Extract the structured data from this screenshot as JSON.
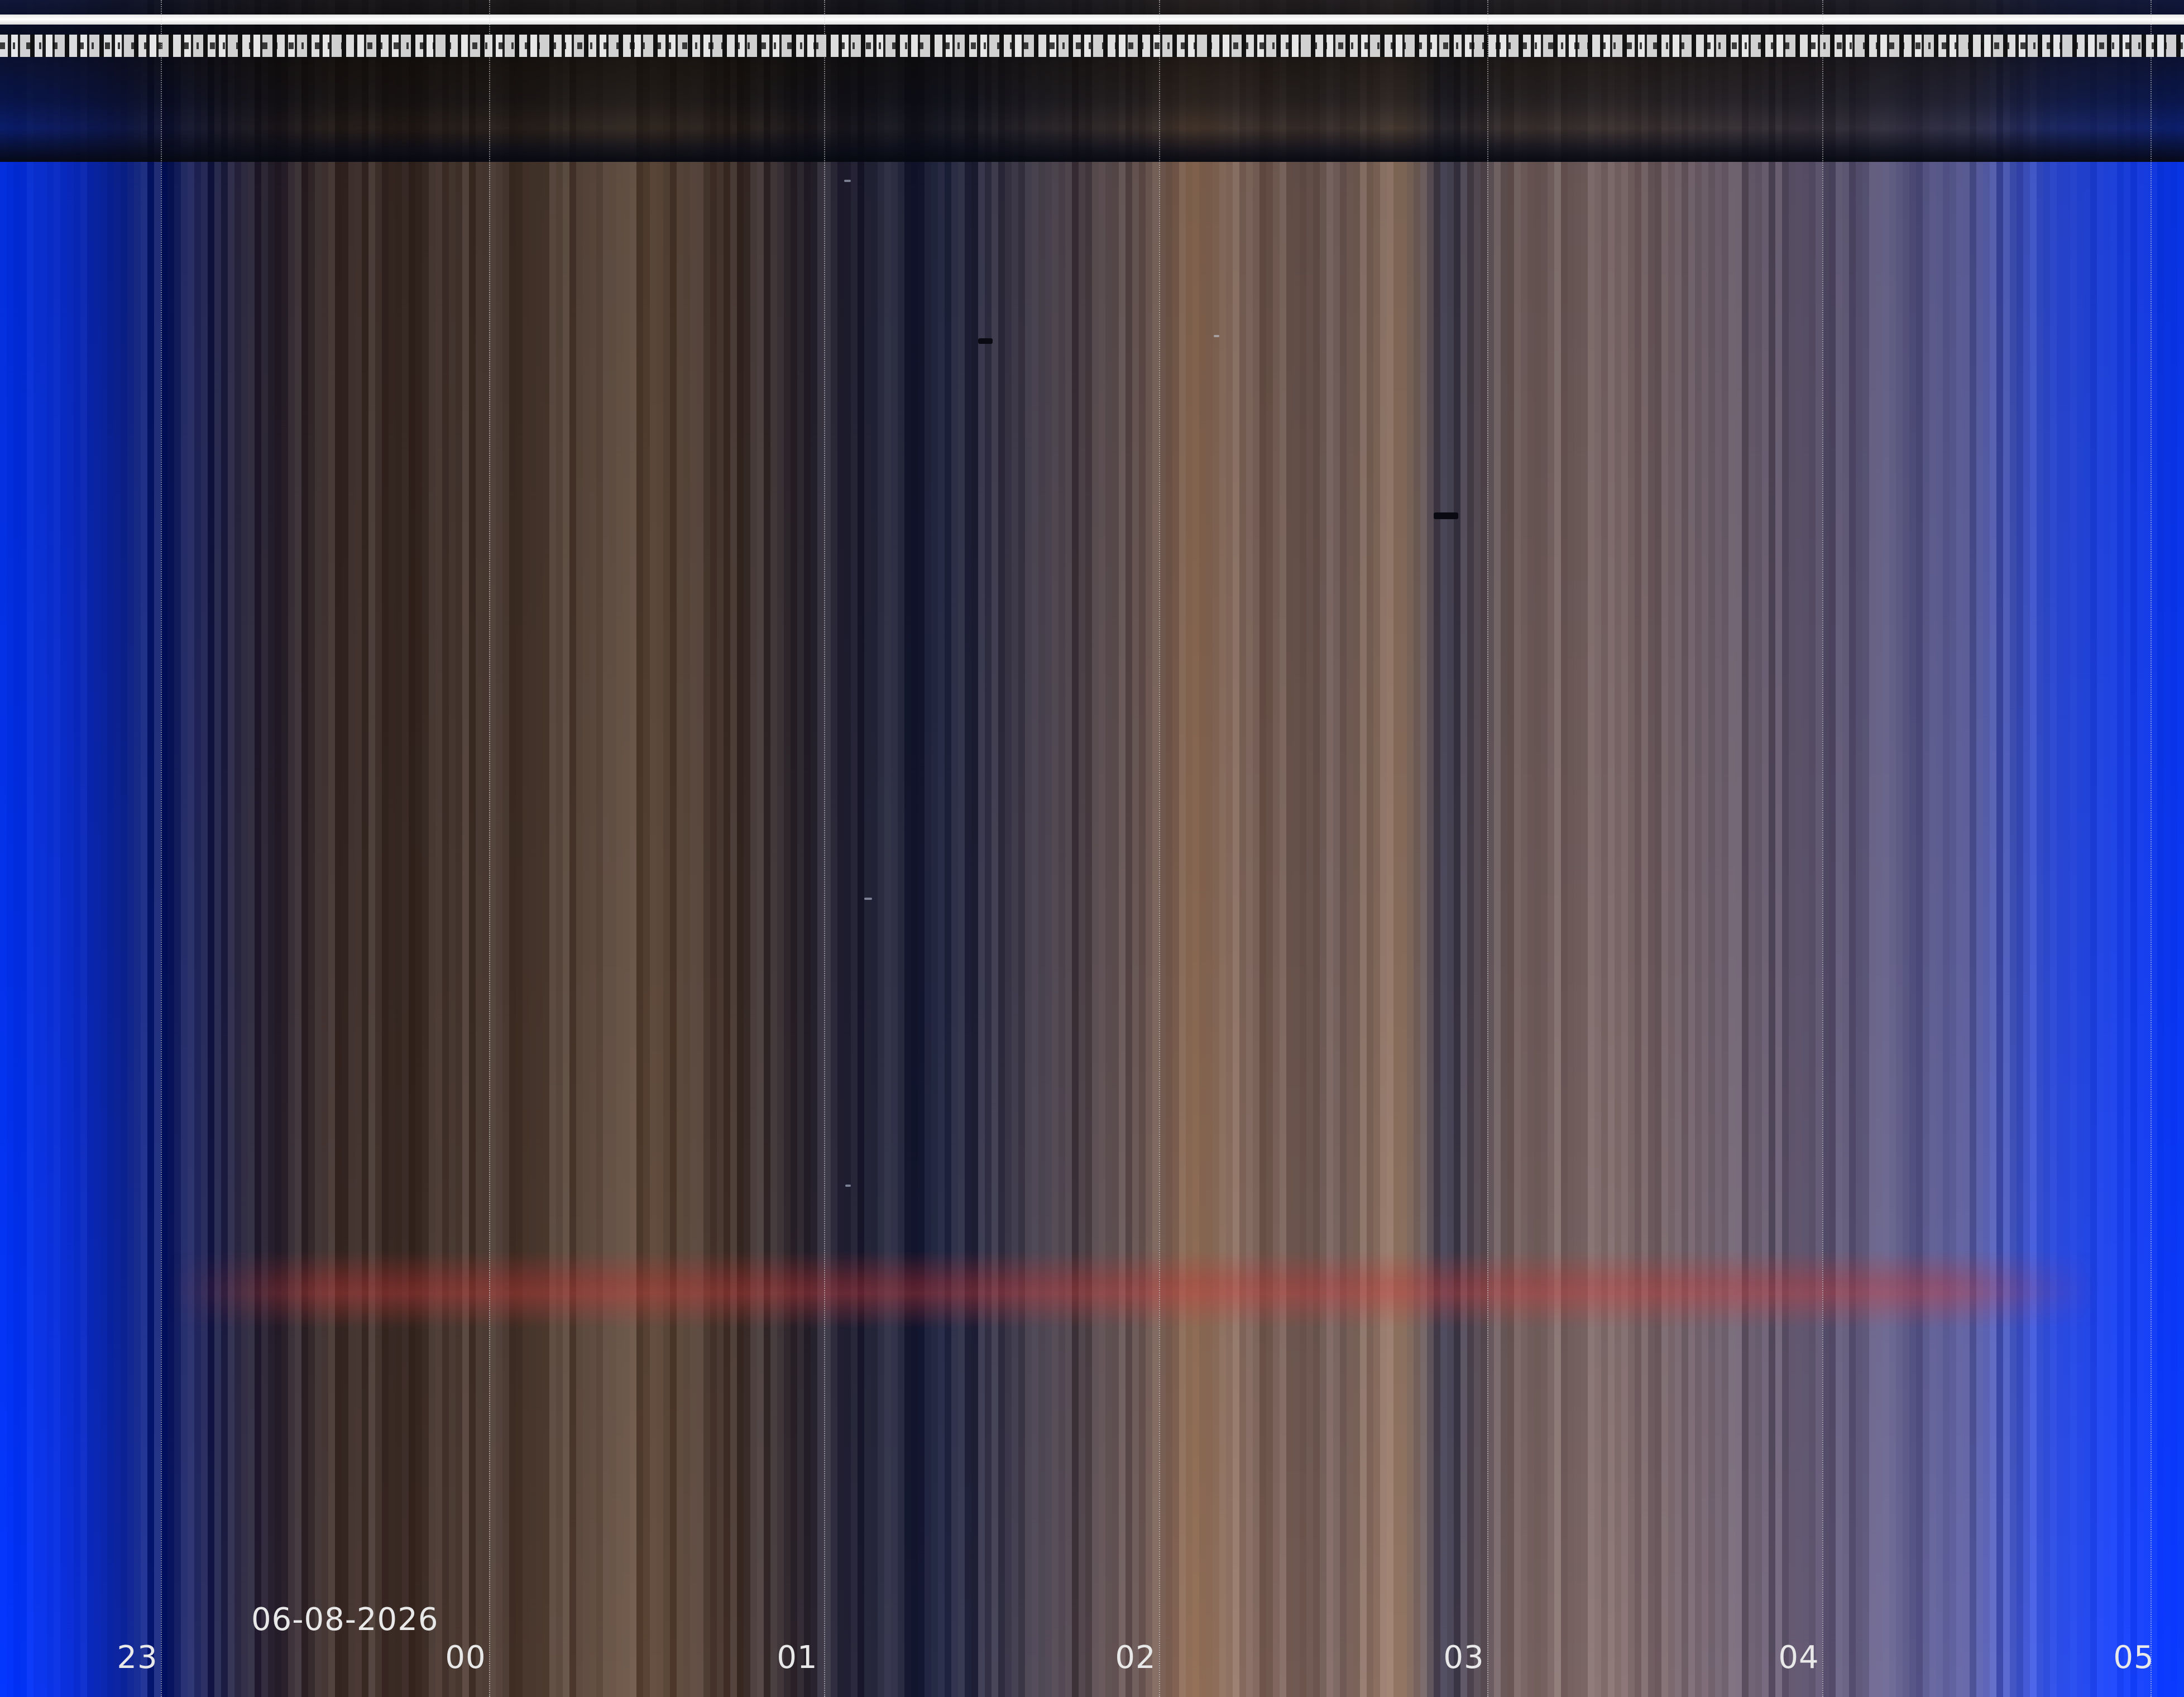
{
  "date_label": "06-08-2026",
  "hour_labels": [
    "23",
    "00",
    "01",
    "02",
    "03",
    "04",
    "05"
  ],
  "colors": {
    "edge_blue": "#0a3cff",
    "sky_brown": "#4a3a30",
    "highlight_tan": "#a88464",
    "dark_navy": "#1a1e32",
    "red_band": "#c83232"
  }
}
